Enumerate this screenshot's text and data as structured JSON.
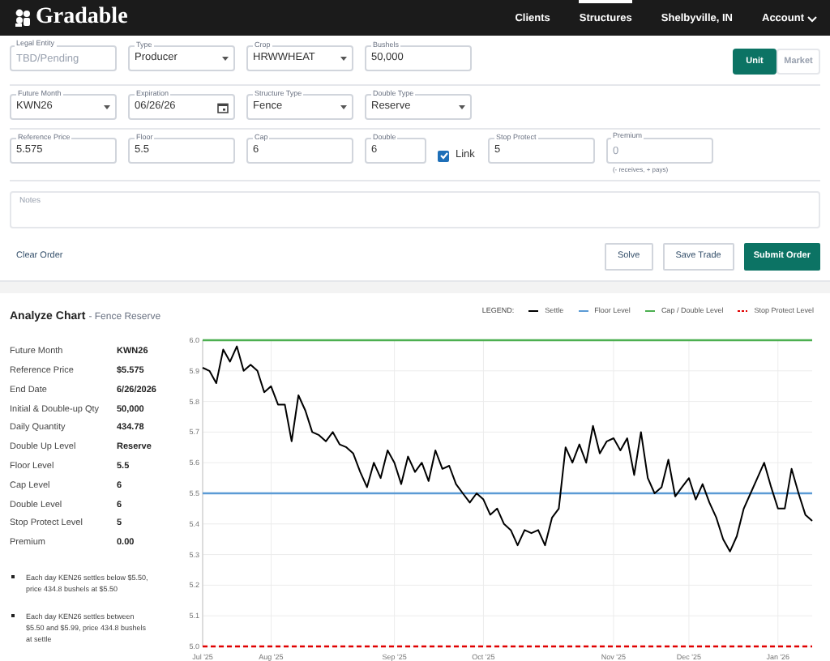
{
  "header": {
    "logo": "Gradable",
    "nav": [
      {
        "label": "Clients",
        "kind": "link",
        "selected": false
      },
      {
        "label": "Structures",
        "kind": "link",
        "selected": true
      },
      {
        "label": "Shelbyville, IN",
        "kind": "link",
        "selected": false
      },
      {
        "label": "Account",
        "kind": "menu",
        "selected": false
      }
    ]
  },
  "form": {
    "rows": [
      [
        {
          "label": "Legal Entity",
          "placeholder": "TBD/Pending",
          "kind": "text"
        },
        {
          "label": "Type",
          "value": "Producer",
          "kind": "select"
        },
        {
          "label": "Crop",
          "value": "HRWWHEAT",
          "kind": "select"
        },
        {
          "label": "Bushels",
          "value": "50,000",
          "kind": "text"
        }
      ],
      [
        {
          "label": "Future Month",
          "value": "KWN26",
          "kind": "select"
        },
        {
          "label": "Expiration",
          "value": "06/26/26",
          "kind": "date"
        },
        {
          "label": "Structure Type",
          "value": "Fence",
          "kind": "select"
        },
        {
          "label": "Double Type",
          "value": "Reserve",
          "kind": "select"
        }
      ],
      [
        {
          "label": "Reference Price",
          "value": "5.575",
          "kind": "text"
        },
        {
          "label": "Floor",
          "value": "5.5",
          "kind": "text"
        },
        {
          "label": "Cap",
          "value": "6",
          "kind": "text"
        },
        {
          "label": "Double",
          "value": "6",
          "kind": "short"
        },
        {
          "label": "Link",
          "kind": "checkbox",
          "checked": true
        },
        {
          "label": "Stop Protect",
          "value": "5",
          "kind": "text"
        },
        {
          "label": "Premium",
          "placeholder": "0",
          "kind": "text",
          "hint": "(- receives, + pays)"
        }
      ]
    ],
    "toggle": [
      {
        "label": "Unit",
        "selected": true
      },
      {
        "label": "Market",
        "selected": false
      }
    ],
    "notes": {
      "placeholder": "Notes"
    },
    "clear": "Clear Order",
    "buttons": [
      {
        "label": "Solve",
        "kind": "outline"
      },
      {
        "label": "Save Trade",
        "kind": "outline"
      },
      {
        "label": "Submit Order",
        "kind": "primary"
      }
    ]
  },
  "analyze": {
    "title": "Analyze Chart",
    "subtitle": "- Fence Reserve",
    "summary": [
      {
        "label": "Future Month",
        "value": "KWN26"
      },
      {
        "label": "Reference Price",
        "value": "$5.575"
      },
      {
        "label": "End Date",
        "value": "6/26/2026"
      },
      {
        "label": "Initial & Double-up Qty",
        "value": "50,000"
      },
      {
        "label": "Daily Quantity",
        "value": "434.78"
      },
      {
        "label": "Double Up Level",
        "value": "Reserve"
      },
      {
        "label": "Floor Level",
        "value": "5.5"
      },
      {
        "label": "Cap Level",
        "value": "6"
      },
      {
        "label": "Double Level",
        "value": "6"
      },
      {
        "label": "Stop Protect Level",
        "value": "5"
      },
      {
        "label": "Premium",
        "value": "0.00"
      }
    ],
    "bullets": [
      "Each day KEN26 settles below $5.50, price 434.8 bushels at $5.50",
      "Each day KEN26 settles between $5.50 and $5.99, price 434.8 bushels at settle"
    ],
    "legend_title": "LEGEND:",
    "chart_data": {
      "type": "line",
      "grid": true,
      "categories": [
        "Jul '25",
        null,
        null,
        null,
        null,
        null,
        null,
        null,
        null,
        null,
        "Aug '25",
        null,
        null,
        null,
        null,
        null,
        null,
        null,
        null,
        null,
        null,
        null,
        null,
        null,
        null,
        null,
        null,
        null,
        "Sep '25",
        null,
        null,
        null,
        null,
        null,
        null,
        null,
        null,
        null,
        null,
        null,
        null,
        "Oct '25",
        null,
        null,
        null,
        null,
        null,
        null,
        null,
        null,
        null,
        null,
        null,
        null,
        null,
        null,
        null,
        null,
        null,
        null,
        "Nov '25",
        null,
        null,
        null,
        null,
        null,
        null,
        null,
        null,
        null,
        null,
        "Dec '25",
        null,
        null,
        null,
        null,
        null,
        null,
        null,
        null,
        null,
        null,
        null,
        null,
        "Jan '26",
        null,
        null,
        null,
        null,
        null
      ],
      "series": [
        {
          "name": "Settle",
          "color": "#000000",
          "values": [
            5.91,
            5.9,
            5.86,
            5.97,
            5.93,
            5.98,
            5.9,
            5.92,
            5.9,
            5.83,
            5.85,
            5.79,
            5.79,
            5.67,
            5.82,
            5.77,
            5.7,
            5.69,
            5.67,
            5.7,
            5.66,
            5.65,
            5.63,
            5.57,
            5.52,
            5.6,
            5.55,
            5.64,
            5.6,
            5.53,
            5.62,
            5.57,
            5.6,
            5.54,
            5.64,
            5.58,
            5.59,
            5.53,
            5.5,
            5.47,
            5.5,
            5.48,
            5.43,
            5.45,
            5.4,
            5.38,
            5.33,
            5.38,
            5.37,
            5.38,
            5.33,
            5.42,
            5.45,
            5.65,
            5.6,
            5.66,
            5.6,
            5.72,
            5.63,
            5.67,
            5.68,
            5.64,
            5.68,
            5.56,
            5.7,
            5.55,
            5.5,
            5.52,
            5.61,
            5.49,
            5.52,
            5.55,
            5.48,
            5.53,
            5.47,
            5.42,
            5.35,
            5.31,
            5.36,
            5.45,
            5.5,
            5.55,
            5.6,
            5.52,
            5.45,
            5.45,
            5.58,
            5.5,
            5.43,
            5.41
          ]
        },
        {
          "name": "Floor Level",
          "color": "#5b9bd5",
          "values": [
            5.5,
            5.5,
            5.5,
            5.5,
            5.5,
            5.5,
            5.5,
            5.5,
            5.5,
            5.5,
            5.5,
            5.5,
            5.5,
            5.5,
            5.5,
            5.5,
            5.5,
            5.5,
            5.5,
            5.5,
            5.5,
            5.5,
            5.5,
            5.5,
            5.5,
            5.5,
            5.5,
            5.5,
            5.5,
            5.5,
            5.5,
            5.5,
            5.5,
            5.5,
            5.5,
            5.5,
            5.5,
            5.5,
            5.5,
            5.5,
            5.5,
            5.5,
            5.5,
            5.5,
            5.5,
            5.5,
            5.5,
            5.5,
            5.5,
            5.5,
            5.5,
            5.5,
            5.5,
            5.5,
            5.5,
            5.5,
            5.5,
            5.5,
            5.5,
            5.5,
            5.5,
            5.5,
            5.5,
            5.5,
            5.5,
            5.5,
            5.5,
            5.5,
            5.5,
            5.5,
            5.5,
            5.5,
            5.5,
            5.5,
            5.5,
            5.5,
            5.5,
            5.5,
            5.5,
            5.5,
            5.5,
            5.5,
            5.5,
            5.5,
            5.5,
            5.5,
            5.5,
            5.5,
            5.5,
            5.5
          ]
        },
        {
          "name": "Cap / Double Level",
          "color": "#4caf50",
          "values": [
            6,
            6,
            6,
            6,
            6,
            6,
            6,
            6,
            6,
            6,
            6,
            6,
            6,
            6,
            6,
            6,
            6,
            6,
            6,
            6,
            6,
            6,
            6,
            6,
            6,
            6,
            6,
            6,
            6,
            6,
            6,
            6,
            6,
            6,
            6,
            6,
            6,
            6,
            6,
            6,
            6,
            6,
            6,
            6,
            6,
            6,
            6,
            6,
            6,
            6,
            6,
            6,
            6,
            6,
            6,
            6,
            6,
            6,
            6,
            6,
            6,
            6,
            6,
            6,
            6,
            6,
            6,
            6,
            6,
            6,
            6,
            6,
            6,
            6,
            6,
            6,
            6,
            6,
            6,
            6,
            6,
            6,
            6,
            6,
            6,
            6,
            6,
            6,
            6,
            6
          ]
        },
        {
          "name": "Stop Protect Level",
          "color": "#e00000",
          "line_style": "dashed",
          "values": [
            5,
            5,
            5,
            5,
            5,
            5,
            5,
            5,
            5,
            5,
            5,
            5,
            5,
            5,
            5,
            5,
            5,
            5,
            5,
            5,
            5,
            5,
            5,
            5,
            5,
            5,
            5,
            5,
            5,
            5,
            5,
            5,
            5,
            5,
            5,
            5,
            5,
            5,
            5,
            5,
            5,
            5,
            5,
            5,
            5,
            5,
            5,
            5,
            5,
            5,
            5,
            5,
            5,
            5,
            5,
            5,
            5,
            5,
            5,
            5,
            5,
            5,
            5,
            5,
            5,
            5,
            5,
            5,
            5,
            5,
            5,
            5,
            5,
            5,
            5,
            5,
            5,
            5,
            5,
            5,
            5,
            5,
            5,
            5,
            5,
            5,
            5,
            5,
            5,
            5
          ]
        }
      ],
      "ylim": [
        5,
        6
      ],
      "yticks": [
        {
          "value": 5,
          "label": "5.0"
        },
        {
          "value": 5.1,
          "label": "5.1"
        },
        {
          "value": 5.2,
          "label": "5.2"
        },
        {
          "value": 5.3,
          "label": "5.3"
        },
        {
          "value": 5.4,
          "label": "5.4"
        },
        {
          "value": 5.5,
          "label": "5.5"
        },
        {
          "value": 5.6,
          "label": "5.6"
        },
        {
          "value": 5.7,
          "label": "5.7"
        },
        {
          "value": 5.8,
          "label": "5.8"
        },
        {
          "value": 5.9,
          "label": "5.9"
        },
        {
          "value": 6,
          "label": "6.0"
        }
      ]
    }
  }
}
